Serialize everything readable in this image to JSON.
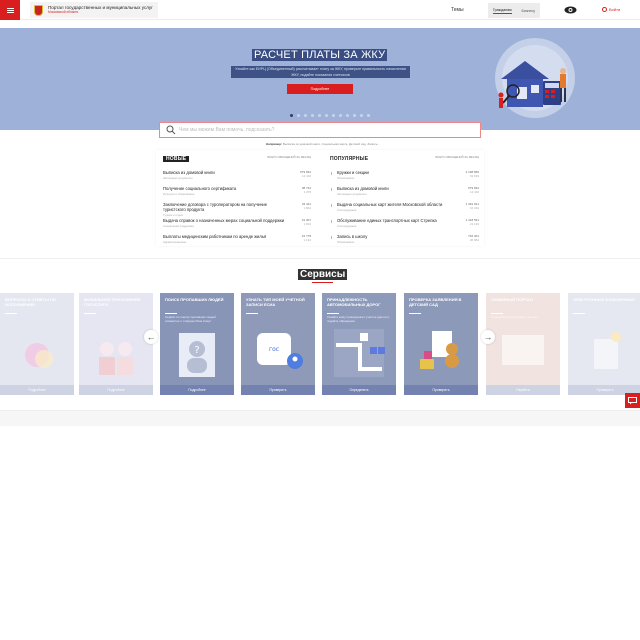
{
  "header": {
    "portal_title": "Портал государственных и муниципальных услуг",
    "portal_subtitle": "Московской области",
    "topics": "Темы",
    "user_types": [
      "Гражданам",
      "Бизнесу"
    ],
    "login": "Войти"
  },
  "hero": {
    "title": "РАСЧЕТ ПЛАТЫ ЗА ЖКУ",
    "description": "Узнайте как ЕИРЦ (Объединенный) рассчитывает плату за ЖКУ, проверьте правильность начисления ЖКУ, подайте показания счетчиков",
    "button": "Подробнее",
    "slides": 12,
    "active_slide": 0
  },
  "search": {
    "placeholder": "Чем мы можем Вам помочь, подсказать?",
    "hints_label": "Например:",
    "hints": "Выписка из домовой книги, Социальная карта, Детский сад, Запись..."
  },
  "new_list": {
    "title": "НОВЫЕ",
    "stat": "ВСЕГО ОБРАЩЕНИЙ ЗА МЕСЯЦ",
    "items": [
      {
        "title": "Выписка из домовой книги",
        "category": "Жилищные документы",
        "total": "679 832",
        "month": "14 418"
      },
      {
        "title": "Получение социального сертификата",
        "category": "Культура и образование",
        "total": "38 742",
        "month": "1 278"
      },
      {
        "title": "Заключение договора с туроператором на получение туристского продукта",
        "category": "Туризм и отдых",
        "total": "23 421",
        "month": "1 842"
      },
      {
        "title": "Выдача справок о назначенных мерах социальной поддержки",
        "category": "Социальная поддержка",
        "total": "21 307",
        "month": "1 810"
      },
      {
        "title": "Выплаты медицинским работникам по аренде жилья",
        "category": "Здравоохранение",
        "total": "16 778",
        "month": "1 132"
      }
    ]
  },
  "popular_list": {
    "title": "ПОПУЛЯРНЫЕ",
    "stat": "ВСЕГО ОБРАЩЕНИЙ ЗА МЕСЯЦ",
    "items": [
      {
        "title": "Кружки и секции",
        "category": "Образование",
        "total": "2 198 866",
        "month": "63 639"
      },
      {
        "title": "Выписка из домовой книги",
        "category": "Жилищные документы",
        "total": "679 832",
        "month": "14 418"
      },
      {
        "title": "Выдача социальных карт жителя Московской области",
        "category": "Соцподдержка",
        "total": "1 391 921",
        "month": "16 332"
      },
      {
        "title": "Обслуживание единых транспортных карт Стрелка",
        "category": "Соцподдержка",
        "total": "1 418 591",
        "month": "21 136"
      },
      {
        "title": "Запись в школу",
        "category": "Образование",
        "total": "746 301",
        "month": "20 984"
      }
    ]
  },
  "services": {
    "title": "Сервисы",
    "cards": [
      {
        "title": "Вопросы и ответы по исполнению",
        "text": "",
        "button": "Подробнее",
        "dim": true,
        "color": "#b5bdd6",
        "icon": "sparkle-icon"
      },
      {
        "title": "Мобильное приложение Госуслуги",
        "text": "",
        "button": "Подробнее",
        "dim": true,
        "color": "#b7b9d9",
        "icon": "family-icon"
      },
      {
        "title": "Поиск пропавших людей",
        "text": "Сервис по поиску пропавших людей совместно с отрядом Лиза Алерт",
        "button": "Подробнее",
        "dim": false,
        "color": "#8995b6",
        "icon": "person-silhouette-icon"
      },
      {
        "title": "Узнать тип моей учетной записи ЕСИА",
        "text": "",
        "button": "Проверить",
        "dim": false,
        "color": "#8f9ab8",
        "icon": "account-type-icon"
      },
      {
        "title": "Принадлежность автомобильных дорог",
        "text": "Узнайте кому принадлежит участок дороги и подайте обращение",
        "button": "Определить",
        "dim": false,
        "color": "#8e9aba",
        "icon": "road-map-icon"
      },
      {
        "title": "Проверка заявления в детский сад",
        "text": "",
        "button": "Проверить",
        "dim": false,
        "color": "#8d99b8",
        "icon": "teddy-bear-icon"
      },
      {
        "title": "Семейный портал",
        "text": "Информация для семей с детьми",
        "button": "Перейти",
        "dim": true,
        "color": "#d9b2a6",
        "icon": "heart-icon"
      },
      {
        "title": "Электронные больничные",
        "text": "",
        "button": "Проверить",
        "dim": true,
        "color": "#b7bed8",
        "icon": "medical-icon"
      }
    ]
  },
  "colors": {
    "brand_red": "#d81e1e",
    "hero_bg": "#9eb1d8",
    "card_bg": "#8e9cba"
  }
}
